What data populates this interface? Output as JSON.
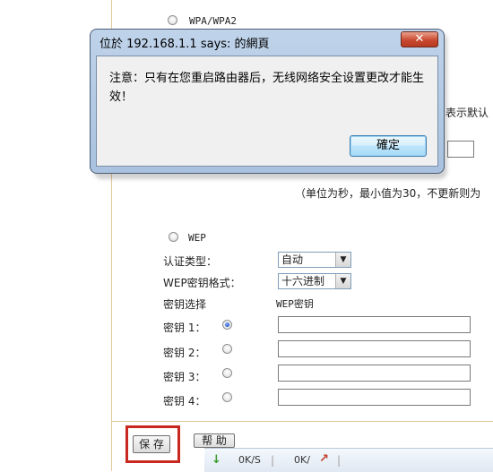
{
  "page": {
    "wpa_label": "WPA/WPA2",
    "hint_default": "表示默认",
    "hint_interval": "（单位为秒，最小值为30，不更新则为",
    "wep_label": "WEP",
    "auth_type_label": "认证类型：",
    "auth_type_value": "自动",
    "wep_format_label": "WEP密钥格式：",
    "wep_format_value": "十六进制",
    "key_select_label": "密钥选择",
    "wep_key_header": "WEP密钥",
    "keys": [
      {
        "label": "密钥 1：",
        "checked": true
      },
      {
        "label": "密钥 2：",
        "checked": false
      },
      {
        "label": "密钥 3：",
        "checked": false
      },
      {
        "label": "密钥 4：",
        "checked": false
      }
    ],
    "save_button": "保 存",
    "help_button": "帮 助"
  },
  "statusbar": {
    "down_speed": "0K/S",
    "up_speed": "0K/"
  },
  "dialog": {
    "title": "位於 192.168.1.1 says: 的網頁",
    "close_glyph": "✕",
    "message": "注意：只有在您重启路由器后，无线网络安全设置更改才能生效！",
    "ok_button": "確定"
  },
  "colors": {
    "highlight": "#c8281f",
    "dialog_frame": "#bfd3ea",
    "page_border": "#e3c99a"
  }
}
